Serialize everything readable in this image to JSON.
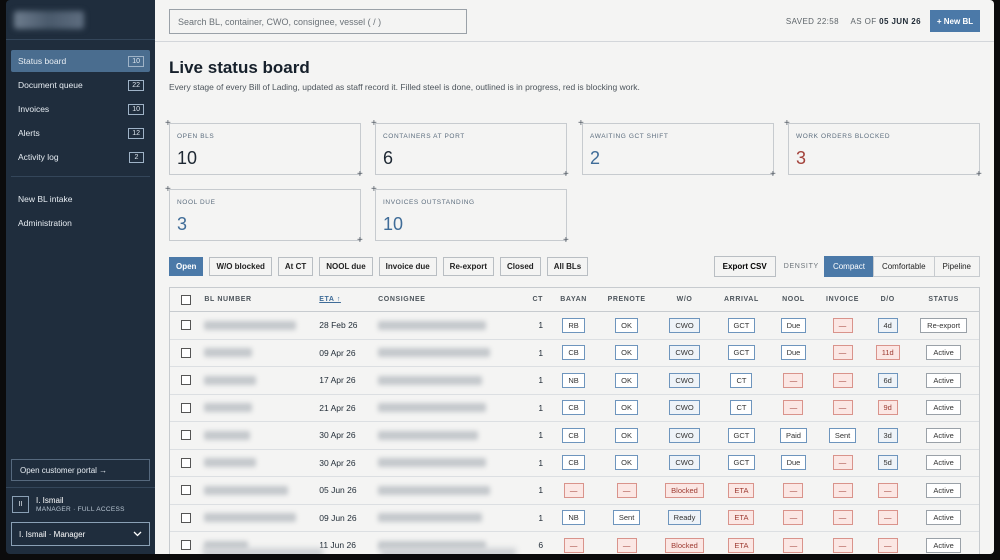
{
  "sidebar": {
    "items": [
      {
        "label": "Status board",
        "count": "10"
      },
      {
        "label": "Document queue",
        "count": "22"
      },
      {
        "label": "Invoices",
        "count": "10"
      },
      {
        "label": "Alerts",
        "count": "12"
      },
      {
        "label": "Activity log",
        "count": "2"
      }
    ],
    "links": [
      "New BL intake",
      "Administration"
    ],
    "portal_label": "Open customer portal →",
    "user_initials": "II",
    "user_name": "I. Ismail",
    "user_role": "MANAGER · FULL ACCESS",
    "user_select": "I. Ismail · Manager"
  },
  "topbar": {
    "search_placeholder": "Search BL, container, CWO, consignee, vessel   ( / )",
    "saved": "SAVED 22:58",
    "asof_label": "AS OF",
    "asof_date": "05 JUN 26",
    "new_bl": "+ New BL"
  },
  "page": {
    "title": "Live status board",
    "subtitle": "Every stage of every Bill of Lading, updated as staff record it. Filled steel is done, outlined is in progress, red is blocking work."
  },
  "cards": [
    {
      "label": "OPEN BLS",
      "value": "10"
    },
    {
      "label": "CONTAINERS AT PORT",
      "value": "6"
    },
    {
      "label": "AWAITING GCT SHIFT",
      "value": "2"
    },
    {
      "label": "WORK ORDERS BLOCKED",
      "value": "3"
    },
    {
      "label": "NOOL DUE",
      "value": "3"
    },
    {
      "label": "INVOICES OUTSTANDING",
      "value": "10"
    }
  ],
  "filters": [
    "Open",
    "W/O blocked",
    "At CT",
    "NOOL due",
    "Invoice due",
    "Re-export",
    "Closed",
    "All BLs"
  ],
  "export_label": "Export CSV",
  "density_label": "DENSITY",
  "density_options": [
    "Compact",
    "Comfortable",
    "Pipeline"
  ],
  "table": {
    "headers": {
      "bl": "BL NUMBER",
      "eta": "ETA ↑",
      "consignee": "CONSIGNEE",
      "ct": "CT",
      "bayan": "BAYAN",
      "prenote": "PRENOTE",
      "wo": "W/O",
      "arrival": "ARRIVAL",
      "nool": "NOOL",
      "invoice": "INVOICE",
      "do": "D/O",
      "status": "STATUS"
    },
    "rows": [
      {
        "eta": "28 Feb 26",
        "ct": "1",
        "bayan": "RB",
        "prenote": "OK",
        "wo": "CWO",
        "arrival": "GCT",
        "nool": "Due",
        "invoice": "—",
        "do": "4d",
        "status": "Re-export"
      },
      {
        "eta": "09 Apr 26",
        "ct": "1",
        "bayan": "CB",
        "prenote": "OK",
        "wo": "CWO",
        "arrival": "GCT",
        "nool": "Due",
        "invoice": "—",
        "do": "11d",
        "status": "Active"
      },
      {
        "eta": "17 Apr 26",
        "ct": "1",
        "bayan": "NB",
        "prenote": "OK",
        "wo": "CWO",
        "arrival": "CT",
        "nool": "—",
        "invoice": "—",
        "do": "6d",
        "status": "Active"
      },
      {
        "eta": "21 Apr 26",
        "ct": "1",
        "bayan": "CB",
        "prenote": "OK",
        "wo": "CWO",
        "arrival": "CT",
        "nool": "—",
        "invoice": "—",
        "do": "9d",
        "status": "Active"
      },
      {
        "eta": "30 Apr 26",
        "ct": "1",
        "bayan": "CB",
        "prenote": "OK",
        "wo": "CWO",
        "arrival": "GCT",
        "nool": "Paid",
        "invoice": "Sent",
        "do": "3d",
        "status": "Active"
      },
      {
        "eta": "30 Apr 26",
        "ct": "1",
        "bayan": "CB",
        "prenote": "OK",
        "wo": "CWO",
        "arrival": "GCT",
        "nool": "Due",
        "invoice": "—",
        "do": "5d",
        "status": "Active"
      },
      {
        "eta": "05 Jun 26",
        "ct": "1",
        "bayan": "—",
        "prenote": "—",
        "wo": "Blocked",
        "arrival": "ETA",
        "nool": "—",
        "invoice": "—",
        "do": "—",
        "status": "Active"
      },
      {
        "eta": "09 Jun 26",
        "ct": "1",
        "bayan": "NB",
        "prenote": "Sent",
        "wo": "Ready",
        "arrival": "ETA",
        "nool": "—",
        "invoice": "—",
        "do": "—",
        "status": "Active"
      },
      {
        "eta": "11 Jun 26",
        "ct": "6",
        "bayan": "—",
        "prenote": "—",
        "wo": "Blocked",
        "arrival": "ETA",
        "nool": "—",
        "invoice": "—",
        "do": "—",
        "status": "Active"
      }
    ]
  },
  "colors": {
    "accent": "#4b79a8",
    "sidebar": "#1f2d3d",
    "blocked": "#a3423b"
  }
}
